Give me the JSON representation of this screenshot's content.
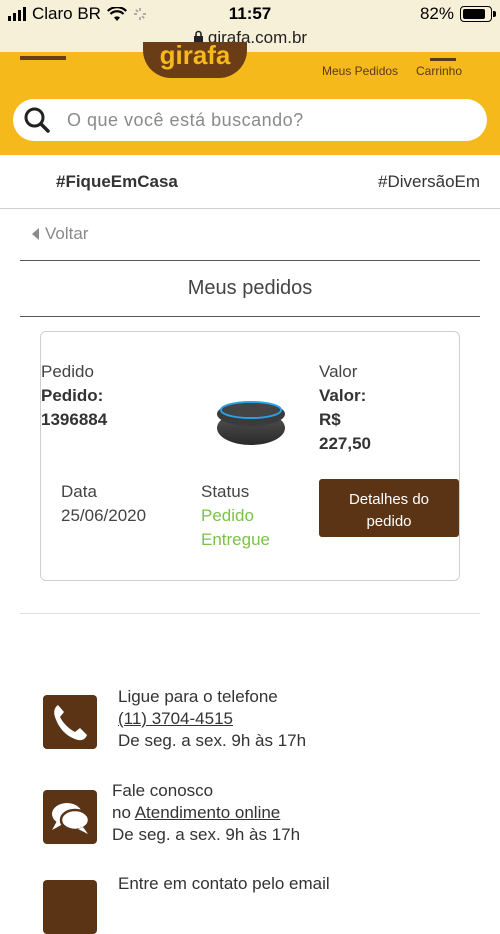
{
  "status": {
    "carrier": "Claro BR",
    "time": "11:57",
    "battery": "82%"
  },
  "url": "girafa.com.br",
  "header": {
    "logo": "girafa",
    "my_orders": "Meus Pedidos",
    "cart": "Carrinho",
    "search_placeholder": "O que você está buscando?"
  },
  "tags": [
    "#FiqueEmCasa",
    "#DiversãoEm"
  ],
  "back": "Voltar",
  "page_title": "Meus pedidos",
  "order": {
    "order_heading": "Pedido",
    "order_label": "Pedido:",
    "order_number": "1396884",
    "value_heading": "Valor",
    "value_label": "Valor:",
    "currency": "R$",
    "value": "227,50",
    "date_label": "Data",
    "date": "25/06/2020",
    "status_label": "Status",
    "status_line1": "Pedido",
    "status_line2": "Entregue",
    "details_line1": "Detalhes do",
    "details_line2": "pedido"
  },
  "contacts": {
    "phone": {
      "line1": "Ligue para o telefone",
      "number": "(11) 3704-4515",
      "hours": "De seg. a sex. 9h às 17h"
    },
    "chat": {
      "line1": "Fale conosco",
      "prefix": "no",
      "link": "Atendimento online",
      "hours": "De seg. a sex. 9h às 17h"
    },
    "email": {
      "line1": "Entre em contato pelo email"
    }
  },
  "colors": {
    "brand_yellow": "#f6b91b",
    "brand_brown": "#5a3414",
    "status_green": "#7cc14a"
  }
}
